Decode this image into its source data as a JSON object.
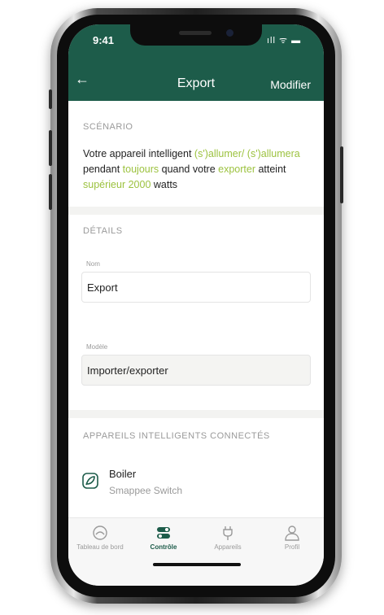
{
  "status_bar": {
    "time": "9:41",
    "icons": "ıll ᯤ ▬"
  },
  "nav": {
    "back_icon": "arrow-left-icon",
    "title": "Export",
    "edit_label": "Modifier"
  },
  "scenario": {
    "label": "SCÉNARIO",
    "parts": [
      "Votre appareil intelligent ",
      "(s')allumer/ (s')allumera",
      " pendant ",
      "toujours",
      " quand votre ",
      "exporter",
      " atteint ",
      "supérieur 2000",
      " watts"
    ],
    "highlight_color": "#9cc23f"
  },
  "details": {
    "label": "DÉTAILS",
    "name_caption": "Nom",
    "name_value": "Export",
    "model_caption": "Modèle",
    "model_value": "Importer/exporter"
  },
  "connected": {
    "label": "APPAREILS INTELLIGENTS CONNECTÉS",
    "devices": [
      {
        "name": "Boiler",
        "type": "Smappee Switch",
        "icon": "leaf-icon"
      }
    ]
  },
  "tabbar": {
    "tabs": [
      {
        "label": "Tableau de bord",
        "icon": "gauge-icon",
        "active": false
      },
      {
        "label": "Contrôle",
        "icon": "toggle-icon",
        "active": true
      },
      {
        "label": "Appareils",
        "icon": "plug-icon",
        "active": false
      },
      {
        "label": "Profil",
        "icon": "person-icon",
        "active": false
      }
    ]
  },
  "colors": {
    "brand": "#1d5c4a",
    "accent": "#9cc23f"
  }
}
